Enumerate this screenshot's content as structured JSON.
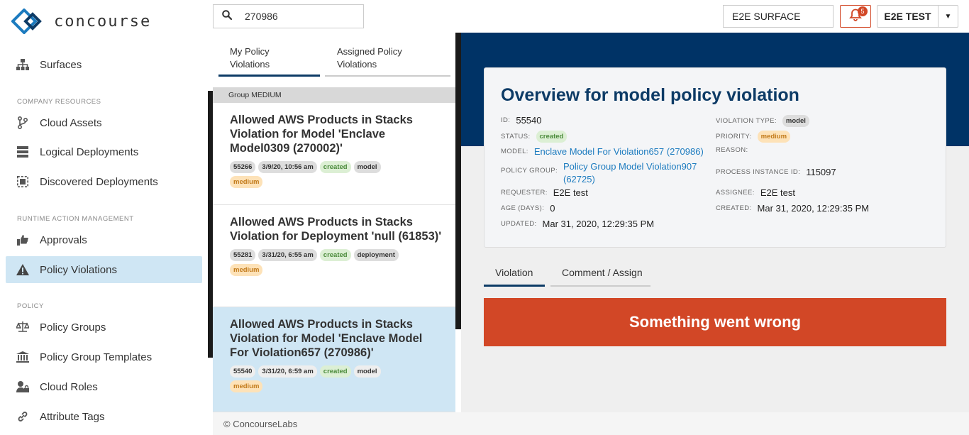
{
  "app": {
    "name": "concourse"
  },
  "sidebar": {
    "top_items": [
      {
        "label": "Surfaces",
        "icon": "sitemap-icon"
      }
    ],
    "sections": [
      {
        "title": "COMPANY RESOURCES",
        "items": [
          {
            "label": "Cloud Assets",
            "icon": "branch-icon"
          },
          {
            "label": "Logical Deployments",
            "icon": "server-icon"
          },
          {
            "label": "Discovered Deployments",
            "icon": "discovered-icon"
          }
        ]
      },
      {
        "title": "RUNTIME ACTION MANAGEMENT",
        "items": [
          {
            "label": "Approvals",
            "icon": "thumbs-up-icon"
          },
          {
            "label": "Policy Violations",
            "icon": "warning-icon",
            "active": true
          }
        ]
      },
      {
        "title": "POLICY",
        "items": [
          {
            "label": "Policy Groups",
            "icon": "scale-icon"
          },
          {
            "label": "Policy Group Templates",
            "icon": "bank-icon"
          },
          {
            "label": "Cloud Roles",
            "icon": "user-lock-icon"
          },
          {
            "label": "Attribute Tags",
            "icon": "link-icon"
          }
        ]
      }
    ]
  },
  "search": {
    "value": "270986",
    "placeholder": ""
  },
  "header": {
    "surface": "E2E SURFACE",
    "notifications_count": "5",
    "user": "E2E TEST"
  },
  "list": {
    "tabs": [
      {
        "label": "My Policy Violations",
        "active": true
      },
      {
        "label": "Assigned Policy Violations",
        "active": false
      }
    ],
    "group_label": "Group MEDIUM",
    "cards": [
      {
        "title": "Allowed AWS Products in Stacks Violation for Model 'Enclave Model0309 (270002)'",
        "tags": [
          "55266",
          "3/9/20, 10:56 am",
          "created",
          "model",
          "medium"
        ],
        "selected": false
      },
      {
        "title": "Allowed AWS Products in Stacks Violation for Deployment 'null (61853)'",
        "tags": [
          "55281",
          "3/31/20, 6:55 am",
          "created",
          "deployment",
          "medium"
        ],
        "selected": false
      },
      {
        "title": "Allowed AWS Products in Stacks Violation for Model 'Enclave Model For Violation657 (270986)'",
        "tags": [
          "55540",
          "3/31/20, 6:59 am",
          "created",
          "model",
          "medium"
        ],
        "selected": true
      }
    ]
  },
  "overview": {
    "title": "Overview for model policy violation",
    "id_label": "ID:",
    "id": "55540",
    "status_label": "STATUS:",
    "status": "created",
    "model_label": "MODEL:",
    "model": "Enclave Model For Violation657 (270986)",
    "policy_group_label": "POLICY GROUP:",
    "policy_group_line1": "Policy Group Model Violation907",
    "policy_group_line2": "(62725)",
    "requester_label": "REQUESTER:",
    "requester": "E2E test",
    "age_label": "AGE (DAYS):",
    "age": "0",
    "updated_label": "UPDATED:",
    "updated": "Mar 31, 2020, 12:29:35 PM",
    "violation_type_label": "VIOLATION TYPE:",
    "violation_type": "model",
    "priority_label": "PRIORITY:",
    "priority": "medium",
    "reason_label": "REASON:",
    "process_instance_label": "PROCESS INSTANCE ID:",
    "process_instance": "115097",
    "assignee_label": "ASSIGNEE:",
    "assignee": "E2E test",
    "created_label": "CREATED:",
    "created": "Mar 31, 2020, 12:29:35 PM"
  },
  "detail_tabs": [
    {
      "label": "Violation",
      "active": true
    },
    {
      "label": "Comment / Assign",
      "active": false
    }
  ],
  "error_message": "Something went wrong",
  "footer": {
    "text": "© ConcourseLabs"
  },
  "colors": {
    "accent_navy": "#003366",
    "active_bg": "#cfe6f4",
    "error": "#d24726"
  }
}
